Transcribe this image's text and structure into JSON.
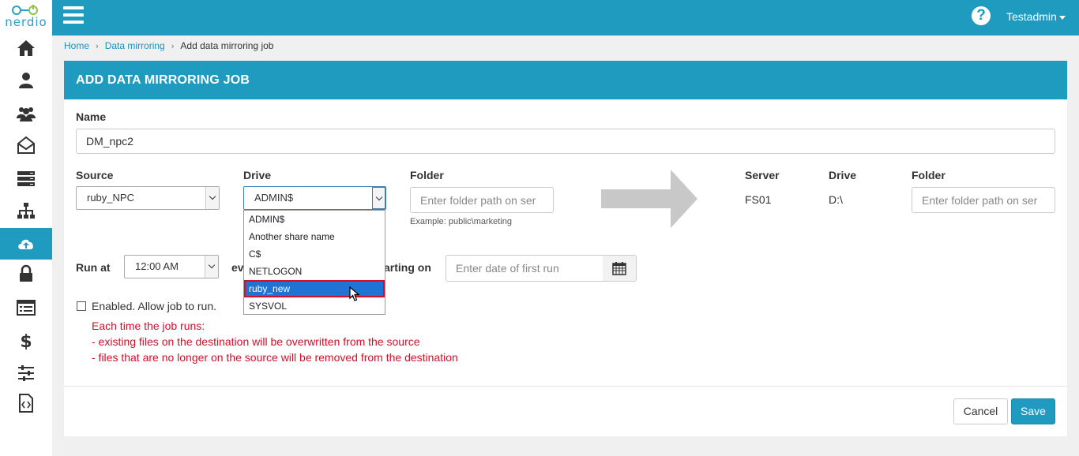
{
  "brand": {
    "logo_text": "nerdio"
  },
  "sidebar": {
    "items": [
      {
        "icon": "home-icon"
      },
      {
        "icon": "user-icon"
      },
      {
        "icon": "users-icon"
      },
      {
        "icon": "mail-icon"
      },
      {
        "icon": "server-icon"
      },
      {
        "icon": "sitemap-icon"
      },
      {
        "icon": "cloud-upload-icon",
        "active": true
      },
      {
        "icon": "lock-icon"
      },
      {
        "icon": "list-icon"
      },
      {
        "icon": "dollar-icon"
      },
      {
        "icon": "sliders-icon"
      },
      {
        "icon": "code-file-icon"
      }
    ]
  },
  "topbar": {
    "help": "?",
    "user": "Testadmin"
  },
  "breadcrumb": {
    "home": "Home",
    "section": "Data mirroring",
    "current": "Add data mirroring job"
  },
  "form": {
    "title": "ADD DATA MIRRORING JOB",
    "name_label": "Name",
    "name_value": "DM_npc2",
    "source_label": "Source",
    "source_value": "ruby_NPC",
    "drive_label": "Drive",
    "drive_value": "ADMIN$",
    "folder_label": "Folder",
    "folder_placeholder": "Enter folder path on ser",
    "folder_example": "Example: public\\marketing",
    "dest_server_label": "Server",
    "dest_server_value": "FS01",
    "dest_drive_label": "Drive",
    "dest_drive_value": "D:\\",
    "dest_folder_label": "Folder",
    "dest_folder_placeholder": "Enter folder path on ser",
    "run_at_label": "Run at",
    "run_at_value": "12:00 AM",
    "every_label_fragment": "ev",
    "starting_on_fragment": "arting on",
    "date_placeholder": "Enter date of first run",
    "enabled_label": "Enabled. Allow job to run.",
    "warning": [
      "Each time the job runs:",
      "- existing files on the destination will be overwritten from the source",
      "- files that are no longer on the source will be removed from the destination"
    ],
    "drive_options": [
      "ADMIN$",
      "Another share name",
      "C$",
      "NETLOGON",
      "ruby_new",
      "SYSVOL"
    ],
    "drive_highlighted": "ruby_new",
    "cancel": "Cancel",
    "save": "Save"
  },
  "colors": {
    "primary": "#1f9bbf",
    "warning": "#d0102a",
    "selected_option": "#1e73d4"
  }
}
